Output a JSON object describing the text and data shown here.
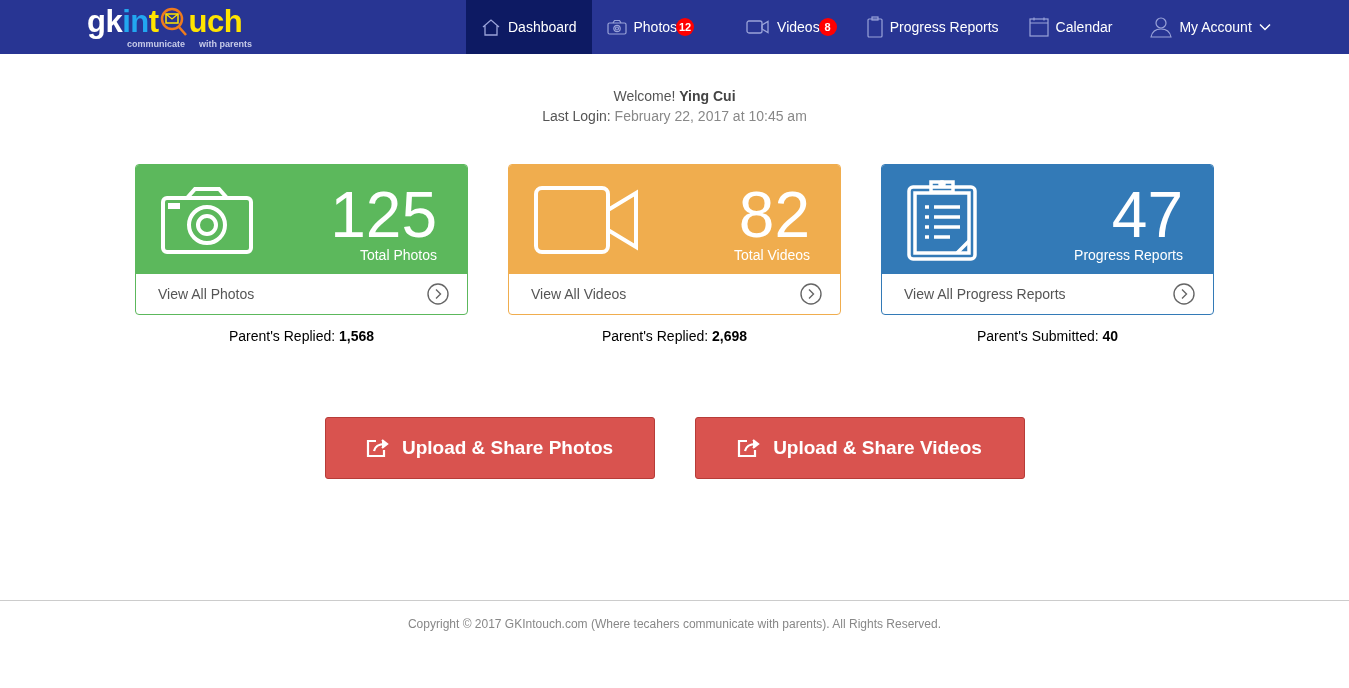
{
  "logo": {
    "parts": [
      {
        "text": "gk",
        "color": "#ffffff"
      },
      {
        "text": "in",
        "color": "#22a7f0"
      },
      {
        "text": "t",
        "color": "#ffe400"
      },
      {
        "text": "uch",
        "color": "#ffe400"
      }
    ],
    "tagline": [
      "communicate",
      "with parents"
    ]
  },
  "nav": [
    {
      "label": "Dashboard",
      "selected": true
    },
    {
      "label": "Photos",
      "badge": "12",
      "selected": false
    },
    {
      "label": "Videos",
      "badge": "8",
      "selected": false
    },
    {
      "label": "Progress Reports",
      "selected": false
    },
    {
      "label": "Calendar",
      "selected": false
    },
    {
      "label": "My Account",
      "dropdown": true,
      "selected": false
    }
  ],
  "welcome": {
    "greeting": "Welcome!",
    "name": "Ying Cui",
    "last_login_label": "Last Login:",
    "last_login": "February 22, 2017 at 10:45 am"
  },
  "cards": [
    {
      "color": "#5cb85c",
      "count": "125",
      "caption": "Total Photos",
      "link": "View All Photos",
      "stat_label": "Parent's Replied:",
      "stat_value": "1,568"
    },
    {
      "color": "#f0ad4e",
      "count": "82",
      "caption": "Total Videos",
      "link": "View All Videos",
      "stat_label": "Parent's Replied:",
      "stat_value": "2,698"
    },
    {
      "color": "#337ab7",
      "count": "47",
      "caption": "Progress Reports",
      "link": "View All Progress Reports",
      "stat_label": "Parent's Submitted:",
      "stat_value": "40"
    }
  ],
  "buttons": [
    "Upload & Share Photos",
    "Upload & Share Videos"
  ],
  "footer": "Copyright © 2017 GKIntouch.com (Where tecahers communicate with parents). All Rights Reserved."
}
